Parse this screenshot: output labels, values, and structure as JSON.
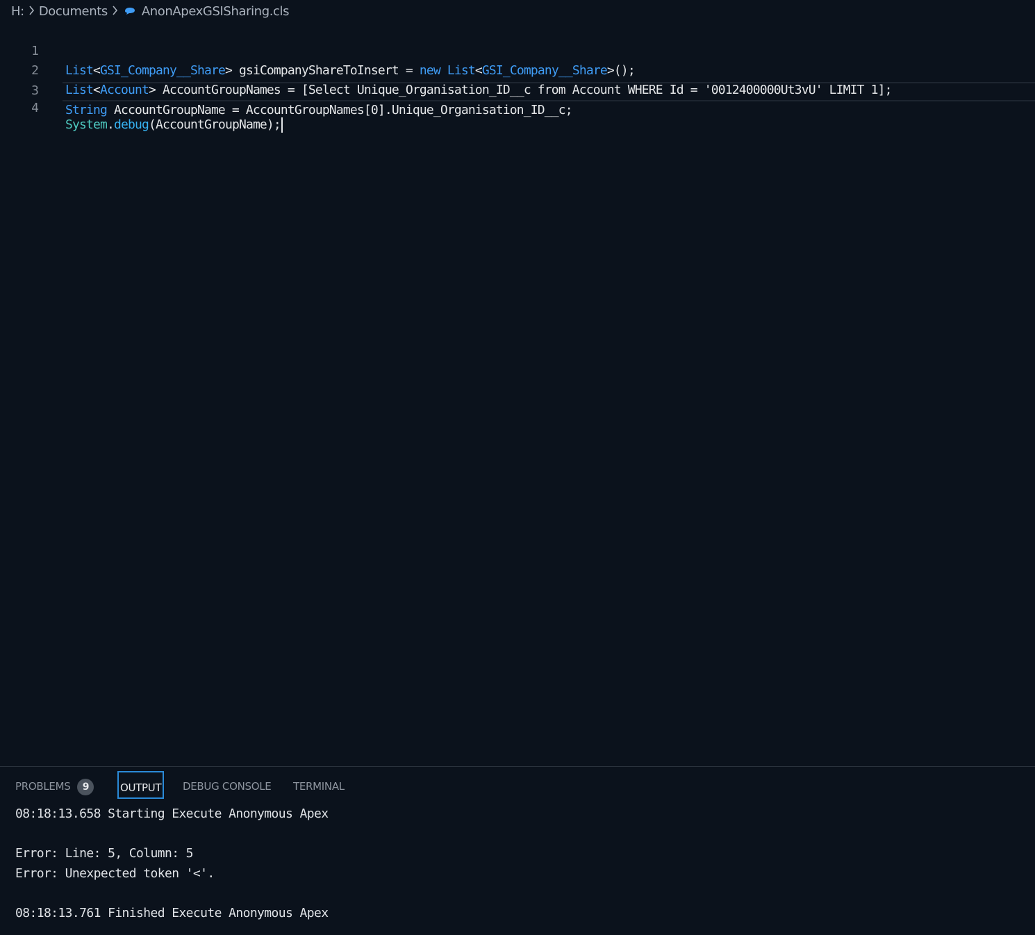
{
  "breadcrumb": {
    "drive": "H:",
    "folder": "Documents",
    "file": "AnonApexGSISharing.cls"
  },
  "editor": {
    "lines": [
      {
        "number": "1",
        "segments": [
          {
            "text": "List",
            "kind": "ty"
          },
          {
            "text": "<",
            "kind": "pl"
          },
          {
            "text": "GSI_Company__Share",
            "kind": "ty"
          },
          {
            "text": "> gsiCompanyShareToInsert = ",
            "kind": "pl"
          },
          {
            "text": "new",
            "kind": "kw"
          },
          {
            "text": " ",
            "kind": "pl"
          },
          {
            "text": "List",
            "kind": "ty"
          },
          {
            "text": "<",
            "kind": "pl"
          },
          {
            "text": "GSI_Company__Share",
            "kind": "ty"
          },
          {
            "text": ">();",
            "kind": "pl"
          }
        ]
      },
      {
        "number": "2",
        "segments": [
          {
            "text": "List",
            "kind": "ty"
          },
          {
            "text": "<",
            "kind": "pl"
          },
          {
            "text": "Account",
            "kind": "ty"
          },
          {
            "text": "> AccountGroupNames = [Select Unique_Organisation_ID__c from Account WHERE Id = '0012400000Ut3vU' LIMIT 1];",
            "kind": "pl"
          }
        ]
      },
      {
        "number": "3",
        "segments": [
          {
            "text": "String",
            "kind": "ty"
          },
          {
            "text": " AccountGroupName = AccountGroupNames[0].Unique_Organisation_ID__c;",
            "kind": "pl"
          }
        ]
      },
      {
        "number": "4",
        "segments": [
          {
            "text": "System",
            "kind": "cl"
          },
          {
            "text": ".",
            "kind": "pl"
          },
          {
            "text": "debug",
            "kind": "fn"
          },
          {
            "text": "(AccountGroupName);",
            "kind": "pl"
          }
        ]
      }
    ]
  },
  "panel": {
    "tabs": {
      "problems": "PROBLEMS",
      "problems_count": "9",
      "output": "OUTPUT",
      "debug_console": "DEBUG CONSOLE",
      "terminal": "TERMINAL"
    },
    "output_lines": [
      "08:18:13.658 Starting Execute Anonymous Apex",
      "",
      "Error: Line: 5, Column: 5",
      "Error: Unexpected token '<'.",
      "",
      "08:18:13.761 Finished Execute Anonymous Apex"
    ]
  },
  "colors": {
    "background": "#0b121c",
    "keyword_blue": "#3f9cf5",
    "class_teal": "#4ec9c0",
    "active_tab_border": "#2a8ad8"
  }
}
